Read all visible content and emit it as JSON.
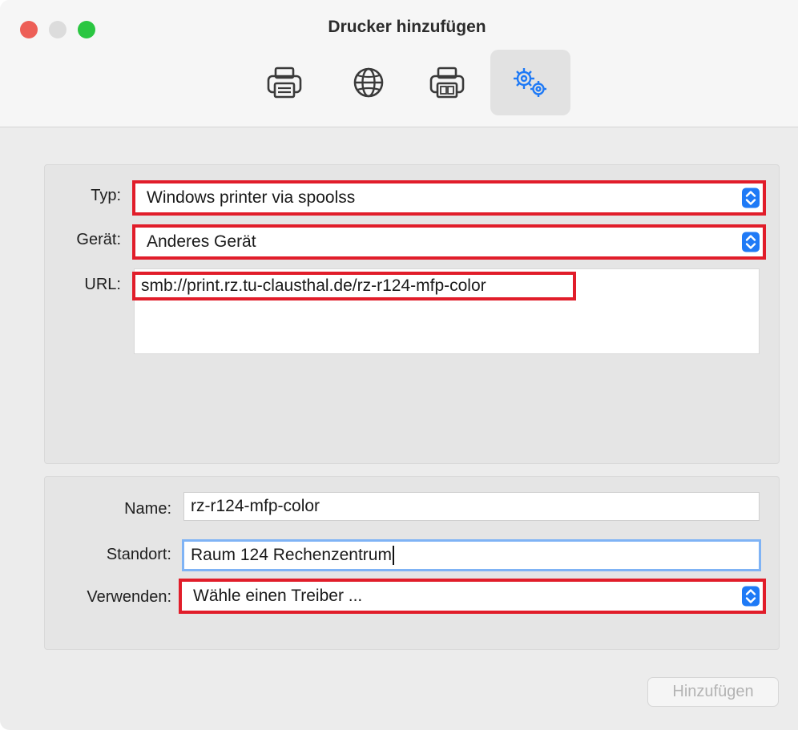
{
  "window": {
    "title": "Drucker hinzufügen"
  },
  "toolbar": {
    "items": [
      {
        "icon": "printer-icon"
      },
      {
        "icon": "globe-icon"
      },
      {
        "icon": "fax-printer-icon"
      },
      {
        "icon": "advanced-gears-icon",
        "selected": true
      }
    ]
  },
  "connection": {
    "type_label": "Typ:",
    "type_value": "Windows printer via spoolss",
    "device_label": "Gerät:",
    "device_value": "Anderes Gerät",
    "url_label": "URL:",
    "url_value": "smb://print.rz.tu-clausthal.de/rz-r124-mfp-color"
  },
  "details": {
    "name_label": "Name:",
    "name_value": "rz-r124-mfp-color",
    "location_label": "Standort:",
    "location_value": "Raum 124 Rechenzentrum",
    "use_label": "Verwenden:",
    "use_value": "Wähle einen Treiber ..."
  },
  "footer": {
    "add_label": "Hinzufügen"
  },
  "colors": {
    "highlight": "#e11d2a",
    "accent": "#1f7af6",
    "focus_ring": "#7fb3f5"
  }
}
